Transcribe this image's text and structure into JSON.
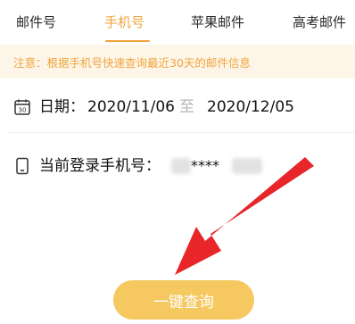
{
  "tabs": [
    {
      "label": "邮件号"
    },
    {
      "label": "手机号"
    },
    {
      "label": "苹果邮件"
    },
    {
      "label": "高考邮件"
    }
  ],
  "active_tab_index": 1,
  "notice": {
    "text": "注意：根据手机号快速查询最近30天的邮件信息"
  },
  "date_row": {
    "label": "日期：",
    "start": "2020/11/06",
    "separator": "至",
    "end": "2020/12/05"
  },
  "phone_row": {
    "label": "当前登录手机号：",
    "masked": "****"
  },
  "query_button": {
    "label": "一键查询"
  },
  "colors": {
    "accent": "#f0a43d",
    "notice_bg": "#fdf6e8",
    "button_bg": "#f5c860",
    "arrow": "#e8262a"
  },
  "icons": {
    "date": "calendar-icon",
    "phone": "mobile-phone-icon",
    "overlay": "red-arrow-icon"
  }
}
